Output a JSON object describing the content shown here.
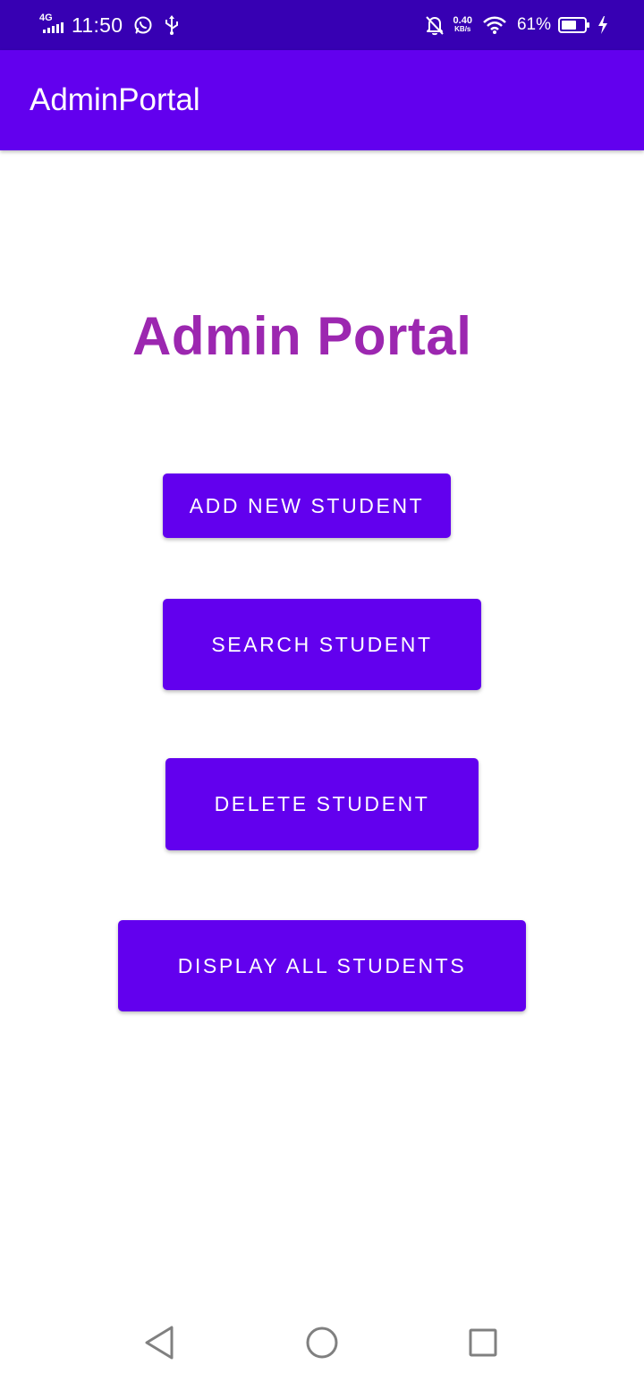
{
  "status_bar": {
    "network_type": "4G",
    "time": "11:50",
    "speed_value": "0.40",
    "speed_unit": "KB/s",
    "battery_percent": "61%",
    "icons": [
      "signal-icon",
      "whatsapp-icon",
      "usb-icon",
      "notifications-off-icon",
      "wifi-icon",
      "battery-icon",
      "charging-icon"
    ]
  },
  "app_bar": {
    "title": "AdminPortal"
  },
  "main": {
    "heading": "Admin Portal",
    "buttons": {
      "add": "ADD NEW STUDENT",
      "search": "SEARCH STUDENT",
      "delete": "DELETE STUDENT",
      "display": "DISPLAY ALL STUDENTS"
    }
  },
  "nav_bar": {
    "icons": [
      "back-icon",
      "home-icon",
      "recents-icon"
    ]
  },
  "colors": {
    "status_bar": "#3700b3",
    "primary": "#6200ee",
    "heading": "#9c27b0",
    "background": "#ffffff",
    "nav_icon": "#808080"
  }
}
